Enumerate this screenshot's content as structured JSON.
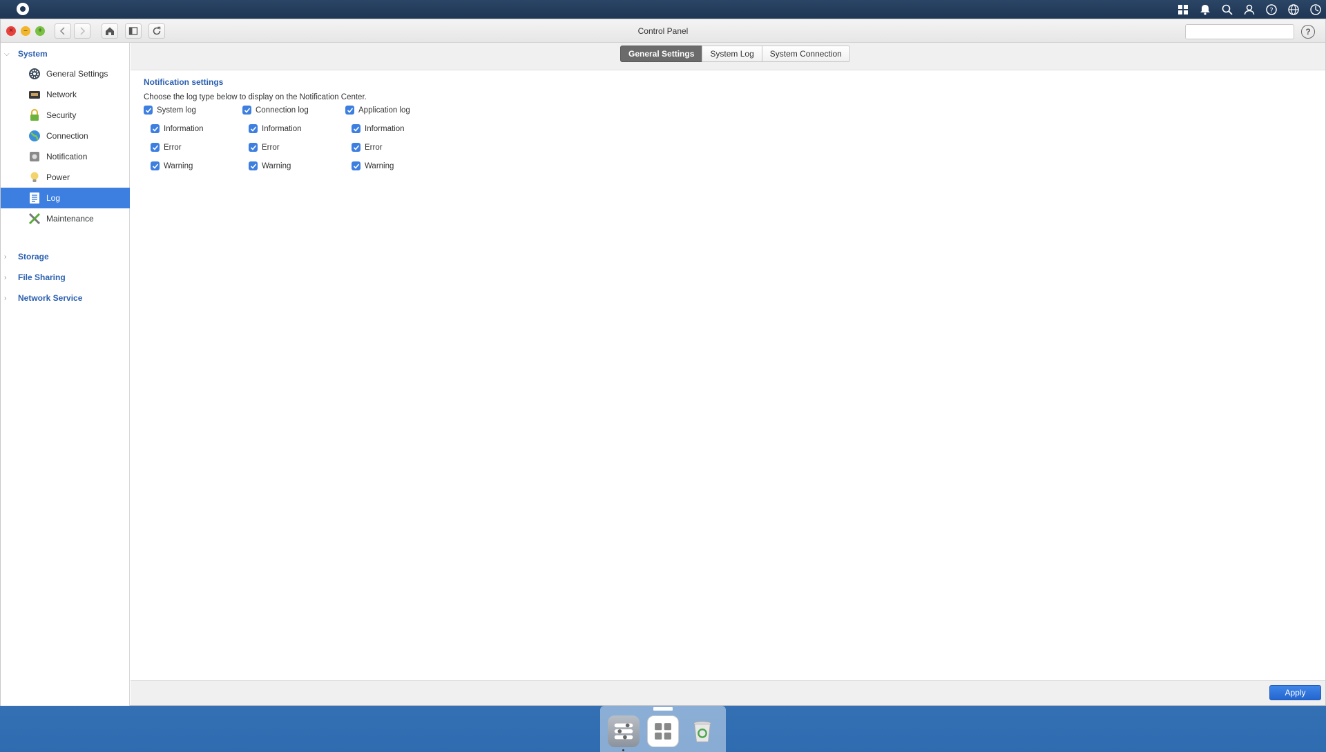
{
  "window": {
    "title": "Control Panel",
    "search_placeholder": ""
  },
  "sidebar": {
    "system_label": "System",
    "items": [
      {
        "label": "General Settings",
        "icon": "gear-icon"
      },
      {
        "label": "Network",
        "icon": "network-icon"
      },
      {
        "label": "Security",
        "icon": "lock-icon"
      },
      {
        "label": "Connection",
        "icon": "globe-icon"
      },
      {
        "label": "Notification",
        "icon": "notification-icon"
      },
      {
        "label": "Power",
        "icon": "bulb-icon"
      },
      {
        "label": "Log",
        "icon": "log-icon"
      },
      {
        "label": "Maintenance",
        "icon": "tools-icon"
      }
    ],
    "collapsed": [
      {
        "label": "Storage"
      },
      {
        "label": "File Sharing"
      },
      {
        "label": "Network Service"
      }
    ]
  },
  "tabs": [
    {
      "label": "General Settings",
      "active": true
    },
    {
      "label": "System Log",
      "active": false
    },
    {
      "label": "System Connection",
      "active": false
    }
  ],
  "notification": {
    "title": "Notification settings",
    "description": "Choose the log type below to display on the Notification Center.",
    "groups": [
      {
        "label": "System log",
        "checked": true,
        "options": [
          {
            "label": "Information",
            "checked": true
          },
          {
            "label": "Error",
            "checked": true
          },
          {
            "label": "Warning",
            "checked": true
          }
        ]
      },
      {
        "label": "Connection log",
        "checked": true,
        "options": [
          {
            "label": "Information",
            "checked": true
          },
          {
            "label": "Error",
            "checked": true
          },
          {
            "label": "Warning",
            "checked": true
          }
        ]
      },
      {
        "label": "Application log",
        "checked": true,
        "options": [
          {
            "label": "Information",
            "checked": true
          },
          {
            "label": "Error",
            "checked": true
          },
          {
            "label": "Warning",
            "checked": true
          }
        ]
      }
    ]
  },
  "footer": {
    "apply_label": "Apply"
  },
  "colors": {
    "accent": "#3d7fe0",
    "link": "#2a5fb0",
    "topbar": "#1f3654"
  }
}
